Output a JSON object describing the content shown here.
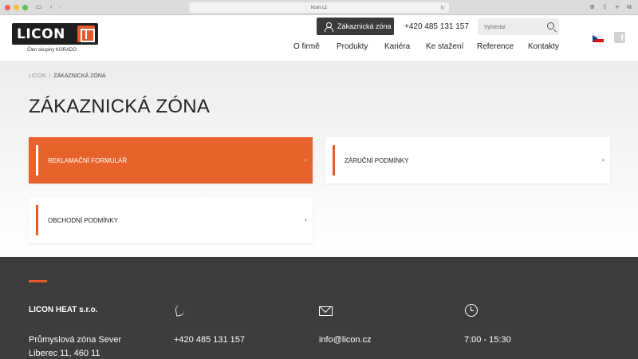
{
  "browser": {
    "url": "licon.cz"
  },
  "header": {
    "logo_text": "LICON",
    "logo_sub": "Člen skupiny KORADO",
    "zone_button": "Zákaznická zóna",
    "phone": "+420 485 131 157",
    "search_placeholder": "Vyhledat",
    "nav": [
      "O firmě",
      "Produkty",
      "Kariéra",
      "Ke stažení",
      "Reference",
      "Kontakty"
    ]
  },
  "breadcrumb": {
    "home": "LICON",
    "current": "ZÁKAZNICKÁ ZÓNA"
  },
  "page_title": "ZÁKAZNICKÁ ZÓNA",
  "cards": [
    {
      "label": "REKLAMAČNÍ FORMULÁŘ",
      "active": true
    },
    {
      "label": "ZÁRUČNÍ PODMÍNKY",
      "active": false
    },
    {
      "label": "OBCHODNÍ PODMÍNKY",
      "active": false
    }
  ],
  "footer": {
    "company": "LICON HEAT s.r.o.",
    "address_line1": "Průmyslová zóna Sever",
    "address_line2": "Liberec 11,  460 11",
    "phone": "+420 485 131 157",
    "email": "info@licon.cz",
    "hours": "7:00 - 15:30"
  },
  "colors": {
    "accent": "#e8592a",
    "dark": "#3d3d3d"
  }
}
